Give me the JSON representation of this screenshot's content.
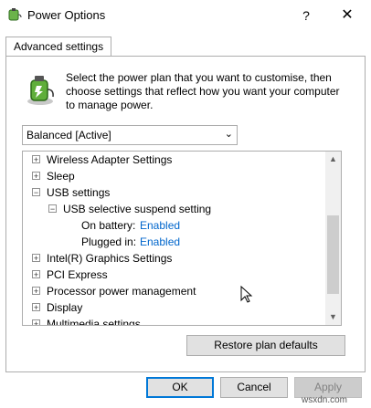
{
  "window": {
    "title": "Power Options",
    "help_label": "?",
    "close_label": "✕"
  },
  "tab": {
    "label": "Advanced settings"
  },
  "intro_text": "Select the power plan that you want to customise, then choose settings that reflect how you want your computer to manage power.",
  "plan_select": {
    "value": "Balanced [Active]"
  },
  "tree": {
    "items": [
      {
        "expander": "+",
        "label": "Wireless Adapter Settings"
      },
      {
        "expander": "+",
        "label": "Sleep"
      },
      {
        "expander": "−",
        "label": "USB settings"
      },
      {
        "expander": "−",
        "label": "USB selective suspend setting"
      },
      {
        "label": "On battery:",
        "value": "Enabled"
      },
      {
        "label": "Plugged in:",
        "value": "Enabled"
      },
      {
        "expander": "+",
        "label": "Intel(R) Graphics Settings"
      },
      {
        "expander": "+",
        "label": "PCI Express"
      },
      {
        "expander": "+",
        "label": "Processor power management"
      },
      {
        "expander": "+",
        "label": "Display"
      },
      {
        "expander": "+",
        "label": "Multimedia settings"
      }
    ]
  },
  "buttons": {
    "restore": "Restore plan defaults",
    "ok": "OK",
    "cancel": "Cancel",
    "apply": "Apply"
  },
  "watermark": "wsxdn.com",
  "colors": {
    "link_value": "#0066cc",
    "focus_border": "#0078d7"
  }
}
